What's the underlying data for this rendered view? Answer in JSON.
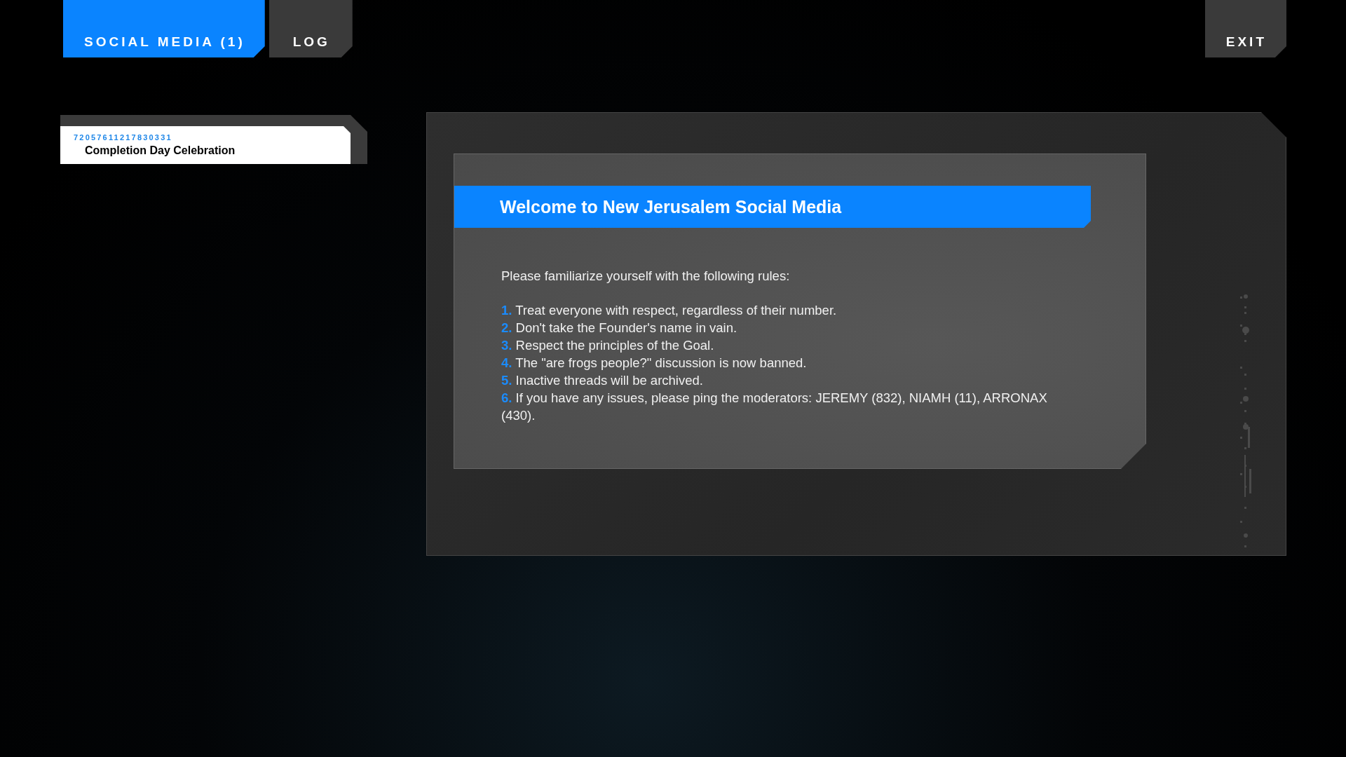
{
  "tabs": [
    {
      "label": "SOCIAL MEDIA (1)",
      "selected": true
    },
    {
      "label": "LOG",
      "selected": false
    }
  ],
  "exit_button": {
    "label": "EXIT"
  },
  "threads": [
    {
      "id": "72057611217830331",
      "title": "Completion Day Celebration"
    }
  ],
  "post": {
    "title": "Welcome to New Jerusalem Social Media",
    "intro": "Please familiarize yourself with the following rules:",
    "rules": [
      {
        "number": "1.",
        "text": "Treat everyone with respect, regardless of their number."
      },
      {
        "number": "2.",
        "text": "Don't take the Founder's name in vain."
      },
      {
        "number": "3.",
        "text": "Respect the principles of the Goal."
      },
      {
        "number": "4.",
        "text": "The \"are frogs people?\" discussion is now banned."
      },
      {
        "number": "5.",
        "text": "Inactive threads will be archived."
      },
      {
        "number": "6.",
        "text": "If you have any issues, please ping the moderators: JEREMY (832), NIAMH (11), ARRONAX (430)."
      }
    ]
  }
}
